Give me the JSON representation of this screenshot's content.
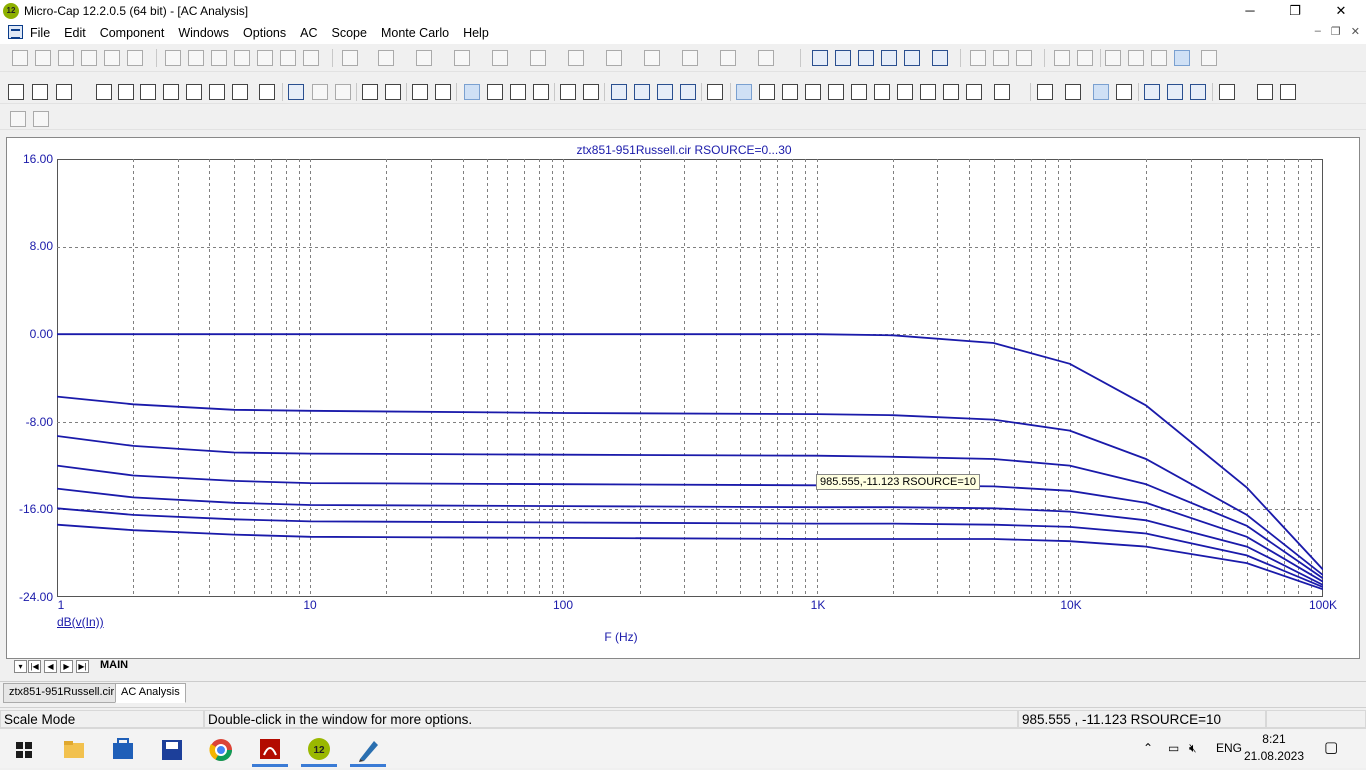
{
  "window": {
    "app_icon_text": "12",
    "title": "Micro-Cap 12.2.0.5 (64 bit) - [AC Analysis]",
    "minimize": "─",
    "restore": "❐",
    "close": "✕"
  },
  "menu": {
    "items": [
      "File",
      "Edit",
      "Component",
      "Windows",
      "Options",
      "AC",
      "Scope",
      "Monte Carlo",
      "Help"
    ],
    "mdi_minimize": "–",
    "mdi_restore": "❐",
    "mdi_close": "✕"
  },
  "plot": {
    "title": "ztx851-951Russell.cir RSOURCE=0...30",
    "trace_expr": "dB(v(In))",
    "x_axis_title": "F (Hz)",
    "tooltip": "985.555,-11.123 RSOURCE=10",
    "line_color": "#1a1aaa",
    "grid_color": "#808080"
  },
  "chart_data": {
    "type": "line",
    "title": "ztx851-951Russell.cir RSOURCE=0...30",
    "xlabel": "F (Hz)",
    "ylabel": "dB(v(In))",
    "xscale": "log",
    "xlim": [
      1,
      100000
    ],
    "ylim": [
      -24,
      16
    ],
    "x_tick_labels": [
      "1",
      "10",
      "100",
      "1K",
      "10K",
      "100K"
    ],
    "y_tick_labels": [
      "16.00",
      "8.00",
      "0.00",
      "-8.00",
      "-16.00",
      "-24.00"
    ],
    "y_ticks": [
      16,
      8,
      0,
      -8,
      -16,
      -24
    ],
    "grid": true,
    "x": [
      1,
      2,
      5,
      10,
      100,
      1000,
      2000,
      5000,
      10000,
      20000,
      50000,
      100000
    ],
    "series": [
      {
        "values": [
          0.0,
          0.0,
          0.0,
          0.0,
          0.0,
          0.0,
          -0.1,
          -0.8,
          -2.7,
          -6.5,
          -14.0,
          -21.5
        ]
      },
      {
        "values": [
          -5.7,
          -6.4,
          -6.9,
          -7.0,
          -7.2,
          -7.3,
          -7.4,
          -7.8,
          -8.8,
          -11.4,
          -16.5,
          -22.0
        ]
      },
      {
        "values": [
          -9.3,
          -10.2,
          -10.8,
          -10.9,
          -11.0,
          -11.1,
          -11.2,
          -11.4,
          -12.0,
          -13.7,
          -17.5,
          -22.3
        ]
      },
      {
        "values": [
          -12.0,
          -12.9,
          -13.4,
          -13.6,
          -13.7,
          -13.8,
          -13.8,
          -13.9,
          -14.3,
          -15.4,
          -18.5,
          -22.6
        ]
      },
      {
        "values": [
          -14.1,
          -14.9,
          -15.4,
          -15.6,
          -15.7,
          -15.8,
          -15.8,
          -15.9,
          -16.2,
          -17.0,
          -19.4,
          -22.9
        ]
      },
      {
        "values": [
          -15.9,
          -16.5,
          -16.9,
          -17.1,
          -17.2,
          -17.3,
          -17.3,
          -17.4,
          -17.6,
          -18.2,
          -20.2,
          -23.1
        ]
      },
      {
        "values": [
          -17.4,
          -17.9,
          -18.3,
          -18.5,
          -18.6,
          -18.7,
          -18.7,
          -18.7,
          -18.9,
          -19.4,
          -20.9,
          -23.3
        ]
      }
    ]
  },
  "page_tabs": {
    "nav": [
      "▾",
      "|◀",
      "◀",
      "▶",
      "▶|"
    ],
    "main_tab": "MAIN"
  },
  "doc_tabs": [
    "ztx851-951Russell.cir",
    "AC Analysis"
  ],
  "status": {
    "mode": "Scale Mode",
    "hint": "Double-click in the window for more options.",
    "readout": "985.555 , -11.123 RSOURCE=10"
  },
  "taskbar": {
    "start_icon": "windows-start",
    "apps": [
      "file-explorer",
      "microsoft-store",
      "micro-cap-schematic",
      "chrome",
      "acrobat",
      "micro-cap",
      "pen-tool"
    ],
    "lang": "ENG",
    "time": "8:21",
    "date": "21.08.2023"
  }
}
